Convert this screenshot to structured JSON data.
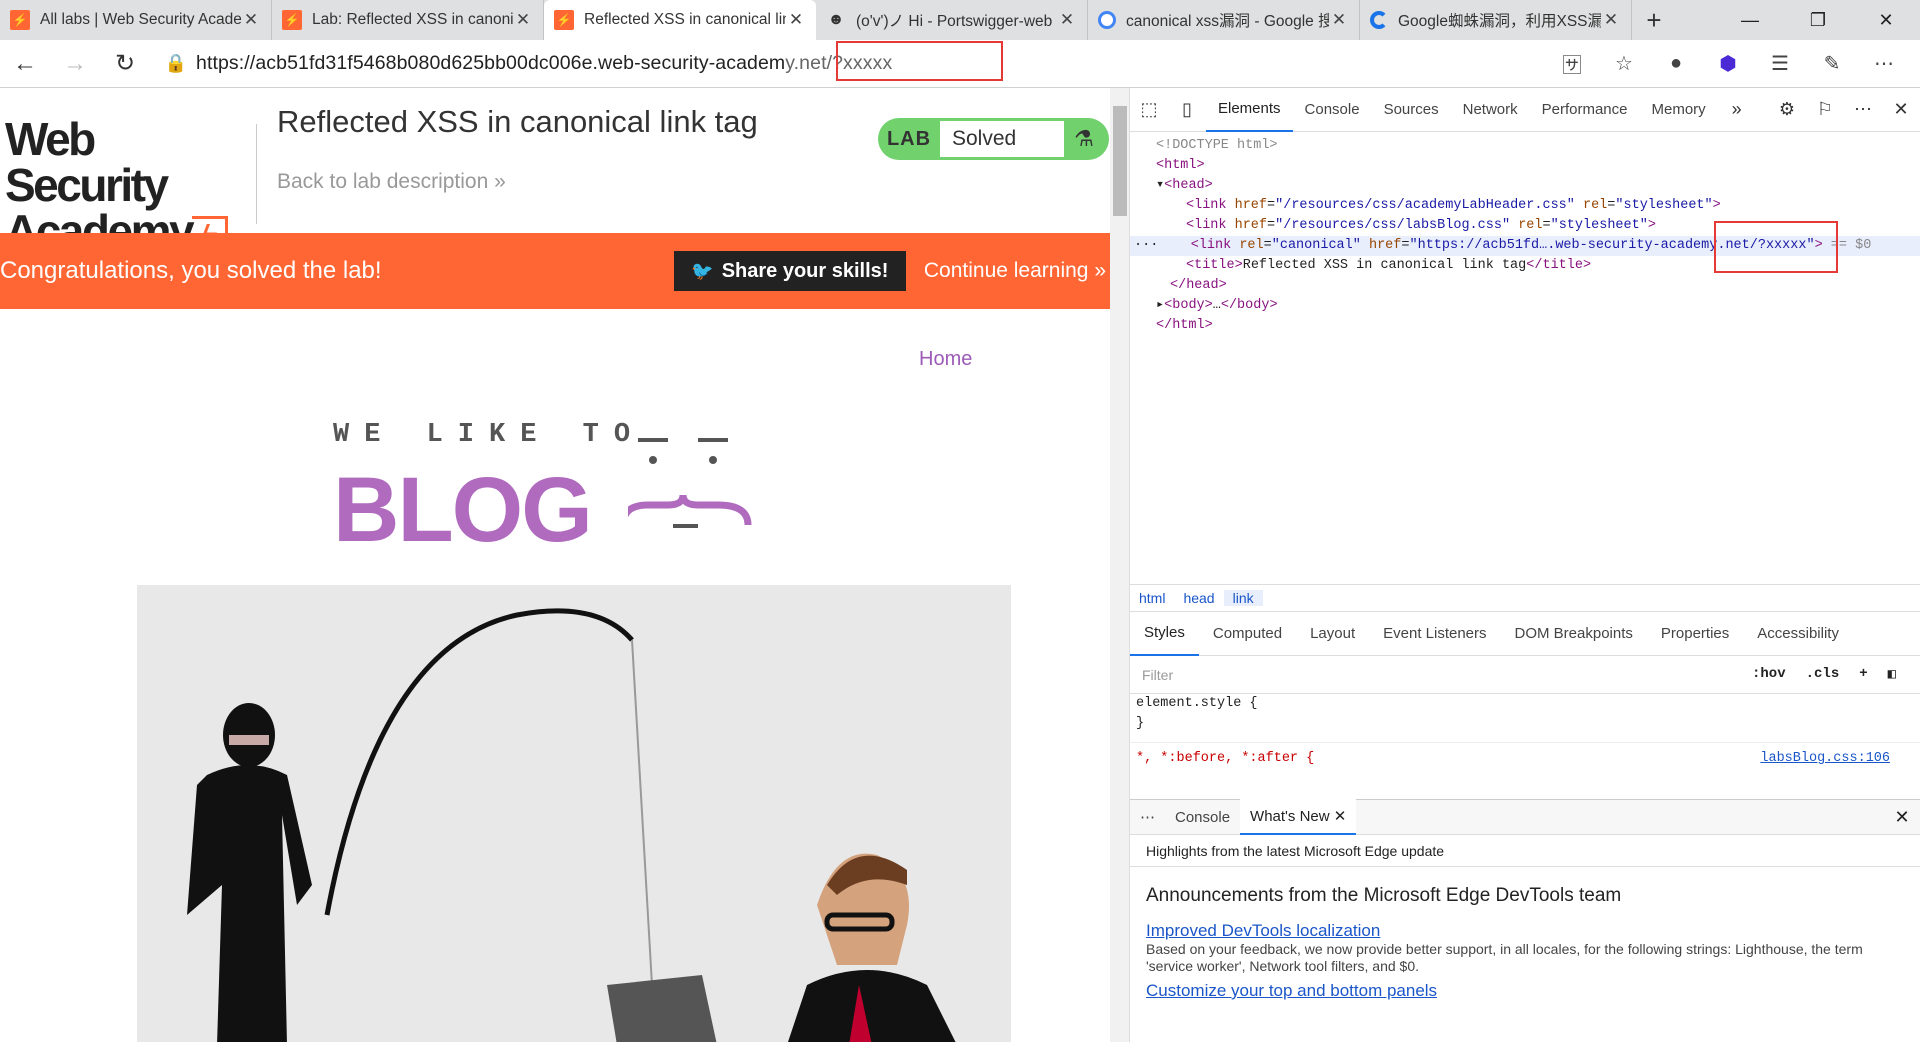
{
  "tabs": [
    {
      "title": "All labs | Web Security Academy",
      "icon": "psa-icon"
    },
    {
      "title": "Lab: Reflected XSS in canonical link tag",
      "icon": "psa-icon"
    },
    {
      "title": "Reflected XSS in canonical link tag",
      "icon": "psa-icon",
      "active": true
    },
    {
      "title": "(o'v')ノ Hi - Portswigger-web",
      "icon": "person-icon"
    },
    {
      "title": "canonical xss漏洞 - Google 搜索",
      "icon": "google-icon"
    },
    {
      "title": "Google蜘蛛漏洞，利用XSS漏洞",
      "icon": "loading-icon"
    }
  ],
  "address": {
    "url_main": "https://acb51fd31f5468b080d625bb00dc006e.web-security-academ",
    "url_tail": "y.net/?xxxxx"
  },
  "lab": {
    "logo_line1": "Web Security",
    "logo_line2": "Academy",
    "title": "Reflected XSS in canonical link tag",
    "back": "Back to lab description",
    "badge_lab": "LAB",
    "badge_status": "Solved",
    "banner_msg": "Congratulations, you solved the lab!",
    "share": "Share your skills!",
    "continue": "Continue learning",
    "home": "Home",
    "blog_top": "WE LIKE TO",
    "blog_big": "BLOG"
  },
  "devtools": {
    "tabs": [
      "Elements",
      "Console",
      "Sources",
      "Network",
      "Performance",
      "Memory"
    ],
    "active_tab": "Elements",
    "breadcrumbs": [
      "html",
      "head",
      "link"
    ],
    "subtabs": [
      "Styles",
      "Computed",
      "Layout",
      "Event Listeners",
      "DOM Breakpoints",
      "Properties",
      "Accessibility"
    ],
    "filter_placeholder": "Filter",
    "hov": ":hov",
    "cls": ".cls",
    "element_style": "element.style {",
    "close_brace": "}",
    "star_rule": "*, *:before, *:after {",
    "star_src": "labsBlog.css:106",
    "drawer_tabs": [
      "Console",
      "What's New"
    ],
    "highlights": "Highlights from the latest Microsoft Edge update",
    "announce_title": "Announcements from the Microsoft Edge DevTools team",
    "link1": "Improved DevTools localization",
    "link1_desc": "Based on your feedback, we now provide better support, in all locales, for the following strings: Lighthouse, the term 'service worker', Network tool filters, and $0.",
    "link2": "Customize your top and bottom panels"
  }
}
